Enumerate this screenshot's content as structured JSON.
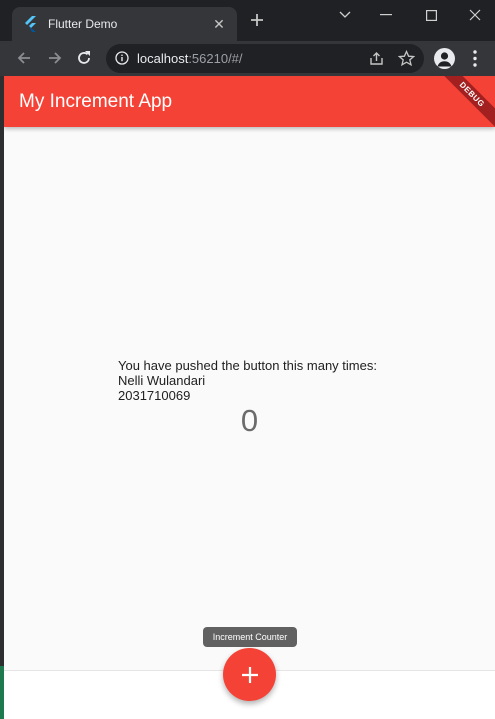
{
  "browser": {
    "tab": {
      "title": "Flutter Demo",
      "favicon": "flutter-logo-icon",
      "close_icon": "close-icon"
    },
    "new_tab_icon": "plus-icon",
    "window_controls": [
      "chevron-down-icon",
      "minimize-icon",
      "maximize-icon",
      "close-icon"
    ],
    "nav": [
      "back-arrow-icon",
      "forward-arrow-icon",
      "reload-icon"
    ],
    "address": {
      "host": "localhost",
      "port_path": ":56210/#/"
    },
    "omnibox_icons": [
      "share-icon",
      "star-icon"
    ],
    "profile_icon": "person-icon",
    "menu_icon": "more-vertical-icon"
  },
  "app": {
    "title": "My Increment App",
    "debug_banner": "DEBUG",
    "message": "You have pushed the button this many times:",
    "name": "Nelli Wulandari",
    "student_id": "2031710069",
    "counter": "0",
    "fab_tooltip": "Increment Counter",
    "fab_icon": "add-icon"
  },
  "colors": {
    "primary": "#f44336",
    "browser_frame": "#202124",
    "toolbar": "#35363a",
    "page_background": "#fafafa"
  }
}
